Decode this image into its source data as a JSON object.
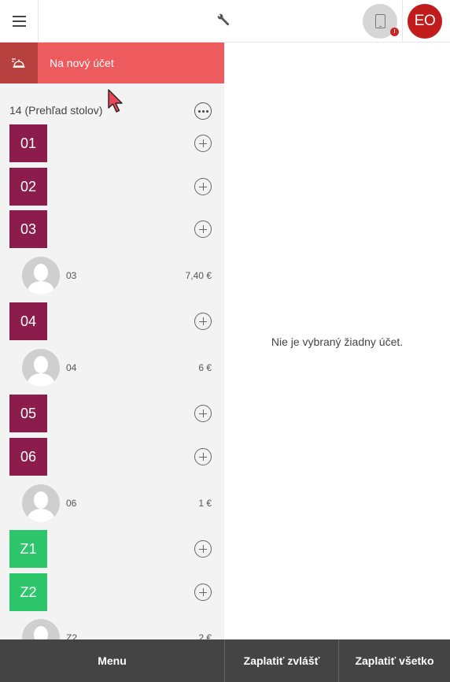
{
  "header": {
    "menu_icon": "hamburger-icon",
    "center_icon": "wrench-icon",
    "device_icon": "tablet-icon",
    "device_badge": "!",
    "user_initials": "EO",
    "colors": {
      "avatar": "#c21b1b",
      "device_bg": "#d6d6d6",
      "badge": "#c62828"
    }
  },
  "sidebar": {
    "new_account": {
      "label": "Na nový účet",
      "icon": "bell-service-icon",
      "color": "#ee5b5e",
      "icon_bg": "#b5403e"
    },
    "overview_label": "14 (Prehľad stolov)",
    "more_icon": "more-horizontal-icon",
    "tables": [
      {
        "id": "01",
        "color": "#8c1c4b"
      },
      {
        "id": "02",
        "color": "#8c1c4b"
      },
      {
        "id": "03",
        "color": "#8c1c4b",
        "account": {
          "name": "03",
          "amount": "7,40 €"
        }
      },
      {
        "id": "04",
        "color": "#8c1c4b",
        "account": {
          "name": "04",
          "amount": "6 €"
        }
      },
      {
        "id": "05",
        "color": "#8c1c4b"
      },
      {
        "id": "06",
        "color": "#8c1c4b",
        "account": {
          "name": "06",
          "amount": "1 €"
        }
      },
      {
        "id": "Z1",
        "color": "#2dc66b"
      },
      {
        "id": "Z2",
        "color": "#2dc66b",
        "account": {
          "name": "Z2",
          "amount": "2 €"
        }
      }
    ]
  },
  "main": {
    "empty_message": "Nie je vybraný žiadny účet."
  },
  "footer": {
    "menu_label": "Menu",
    "pay_separately_label": "Zaplatiť zvlášť",
    "pay_all_label": "Zaplatiť všetko",
    "bg_color": "#444444"
  }
}
